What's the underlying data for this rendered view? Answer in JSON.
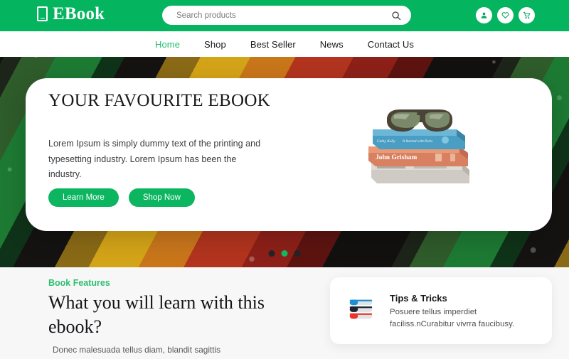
{
  "header": {
    "logo_text": "EBook",
    "logo_icon": "book-tablet-icon",
    "brand_color": "#05b45f",
    "search": {
      "placeholder": "Search products",
      "value": "",
      "icon": "search-icon"
    },
    "actions": [
      {
        "name": "account",
        "icon": "user-icon"
      },
      {
        "name": "wishlist",
        "icon": "heart-icon"
      },
      {
        "name": "cart",
        "icon": "shopping-cart-icon"
      }
    ]
  },
  "nav": {
    "items": [
      {
        "label": "Home",
        "active": true
      },
      {
        "label": "Shop",
        "active": false
      },
      {
        "label": "Best Seller",
        "active": false
      },
      {
        "label": "News",
        "active": false
      },
      {
        "label": "Contact Us",
        "active": false
      }
    ],
    "active_color": "#22c072"
  },
  "hero": {
    "title": "YOUR FAVOURITE EBOOK",
    "body": "Lorem Ipsum is simply dummy text of the printing and typesetting industry. Lorem Ipsum has been the industry.",
    "primary_button": "Learn More",
    "secondary_button": "Shop Now",
    "image_alt": "stack-of-books-with-sunglasses",
    "books": [
      {
        "title": "It Started with Paris",
        "author": "Cathy Kelly",
        "color": "#5aa8cf"
      },
      {
        "title": "",
        "author": "John Grisham",
        "color": "#e08a6e"
      },
      {
        "title": "",
        "author": "",
        "color": "#d8d4cd"
      }
    ],
    "carousel": {
      "total": 3,
      "active_index": 1,
      "active_color": "#10b95f",
      "inactive_color": "#232323"
    }
  },
  "features": {
    "eyebrow": "Book Features",
    "eyebrow_color": "#2bbf70",
    "title": "What you will learn with this ebook?",
    "body": "Donec malesuada tellus diam, blandit sagittis",
    "tips_card": {
      "icon": "stacked-books-icon",
      "title": "Tips & Tricks",
      "text": "Posuere tellus imperdiet\nfaciliss.nCurabitur vivrra faucibusy.",
      "icon_colors": [
        "#1e8fd0",
        "#1c2430",
        "#e8352b"
      ]
    }
  }
}
